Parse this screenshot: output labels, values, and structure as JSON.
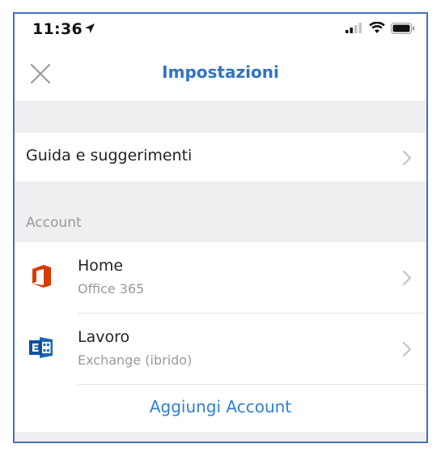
{
  "status_bar": {
    "time": "11:36",
    "icons": [
      "location-arrow-icon",
      "cellular-signal-icon",
      "wifi-icon",
      "battery-icon"
    ]
  },
  "navbar": {
    "title": "Impostazioni",
    "close_icon": "close-icon"
  },
  "help_row": {
    "label": "Guida e suggerimenti"
  },
  "accounts_section": {
    "header": "Account",
    "items": [
      {
        "title": "Home",
        "subtitle": "Office 365",
        "icon": "office-365-icon"
      },
      {
        "title": "Lavoro",
        "subtitle": "Exchange (ibrido)",
        "icon": "exchange-icon"
      }
    ],
    "add_label": "Aggiungi Account"
  },
  "colors": {
    "accent": "#2f73c6",
    "link": "#2f80d0",
    "office_red": "#d83b01",
    "exchange_blue": "#1a66b8",
    "frame_border": "#4a6fb8",
    "background_gray": "#efeff1"
  }
}
